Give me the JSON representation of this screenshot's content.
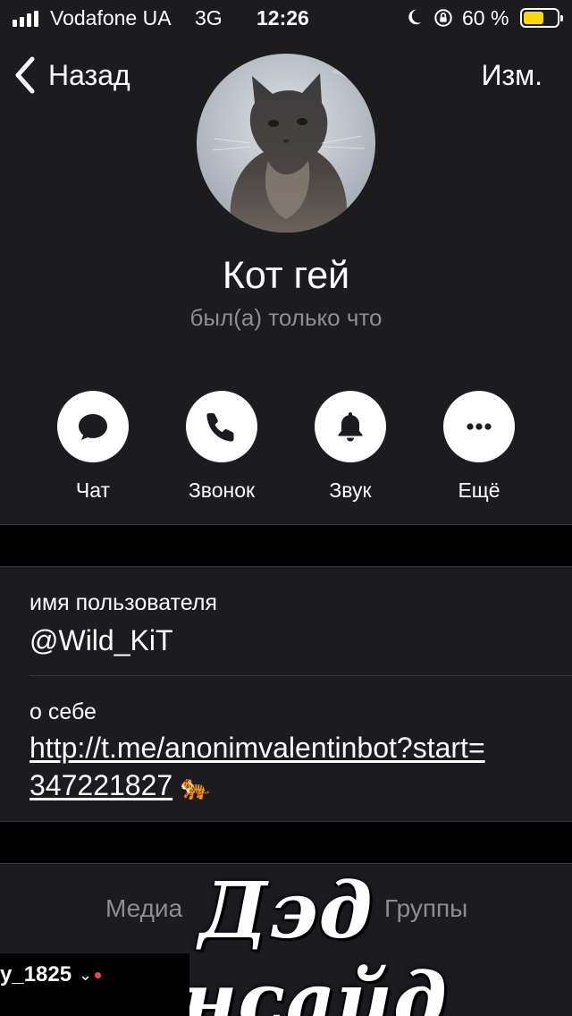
{
  "status_bar": {
    "carrier": "Vodafone UA",
    "network": "3G",
    "time": "12:26",
    "battery_percent": "60 %",
    "battery_level": 0.6,
    "battery_color": "#ffd60a",
    "icons": [
      "signal-icon",
      "moon-icon",
      "rotation-lock-icon",
      "battery-icon"
    ]
  },
  "nav": {
    "back_label": "Назад",
    "edit_label": "Изм."
  },
  "profile": {
    "name": "Кот гей",
    "last_seen": "был(а) только что",
    "avatar_icon": "cat-avatar"
  },
  "actions": [
    {
      "label": "Чат",
      "icon": "chat-bubble-icon"
    },
    {
      "label": "Звонок",
      "icon": "phone-icon"
    },
    {
      "label": "Звук",
      "icon": "bell-icon"
    },
    {
      "label": "Ещё",
      "icon": "more-icon"
    }
  ],
  "info": {
    "username_label": "имя пользователя",
    "username": "@Wild_KiT",
    "bio_label": "о себе",
    "bio_link": "http://t.me/anonimvalentinbot?start=347221827",
    "bio_emoji": "🐅"
  },
  "tabs": {
    "media": "Медиа",
    "groups": "Группы"
  },
  "overlay": {
    "caption": "Дэд инсайд",
    "user_tag": "y_1825"
  },
  "colors": {
    "background": "#1c1c1e",
    "separator_band": "#000000",
    "secondary_text": "#8d8d93",
    "action_circle": "#ffffff"
  }
}
